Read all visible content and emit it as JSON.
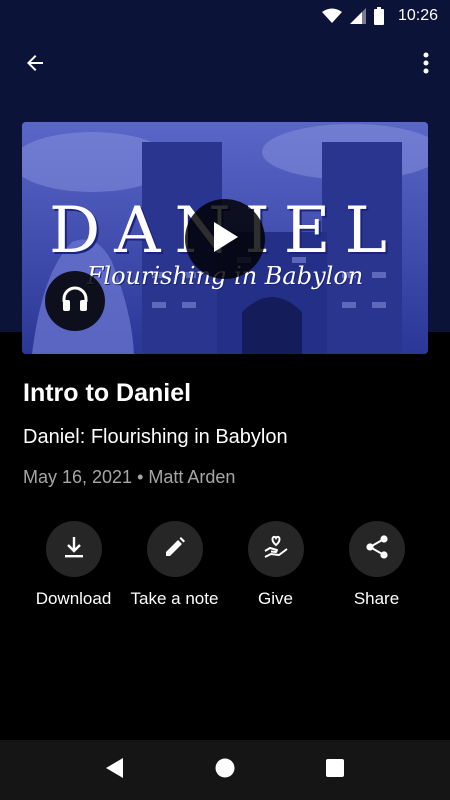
{
  "status_bar": {
    "time": "10:26",
    "icons": [
      "wifi-icon",
      "signal-icon",
      "battery-icon"
    ]
  },
  "app_bar": {
    "back_icon": "arrow-left-icon",
    "menu_icon": "more-vert-icon"
  },
  "artwork": {
    "title_text": "DANIEL",
    "subtitle_text": "Flourishing in Babylon",
    "play_icon": "play-icon",
    "listen_icon": "headphones-icon"
  },
  "episode": {
    "title": "Intro to Daniel",
    "series": "Daniel: Flourishing in Babylon",
    "meta": "May 16, 2021 • Matt Arden"
  },
  "actions": [
    {
      "label": "Download",
      "icon": "download-icon"
    },
    {
      "label": "Take a note",
      "icon": "pencil-icon"
    },
    {
      "label": "Give",
      "icon": "give-heart-hand-icon"
    },
    {
      "label": "Share",
      "icon": "share-icon"
    }
  ],
  "nav_bar": {
    "icons": [
      "nav-back-icon",
      "nav-home-icon",
      "nav-recents-icon"
    ]
  },
  "colors": {
    "top_band": "#0b1339",
    "background": "#000000",
    "action_circle": "#262626",
    "meta_text": "#a6a6a6",
    "artwork_tint": "#3a47b0"
  }
}
